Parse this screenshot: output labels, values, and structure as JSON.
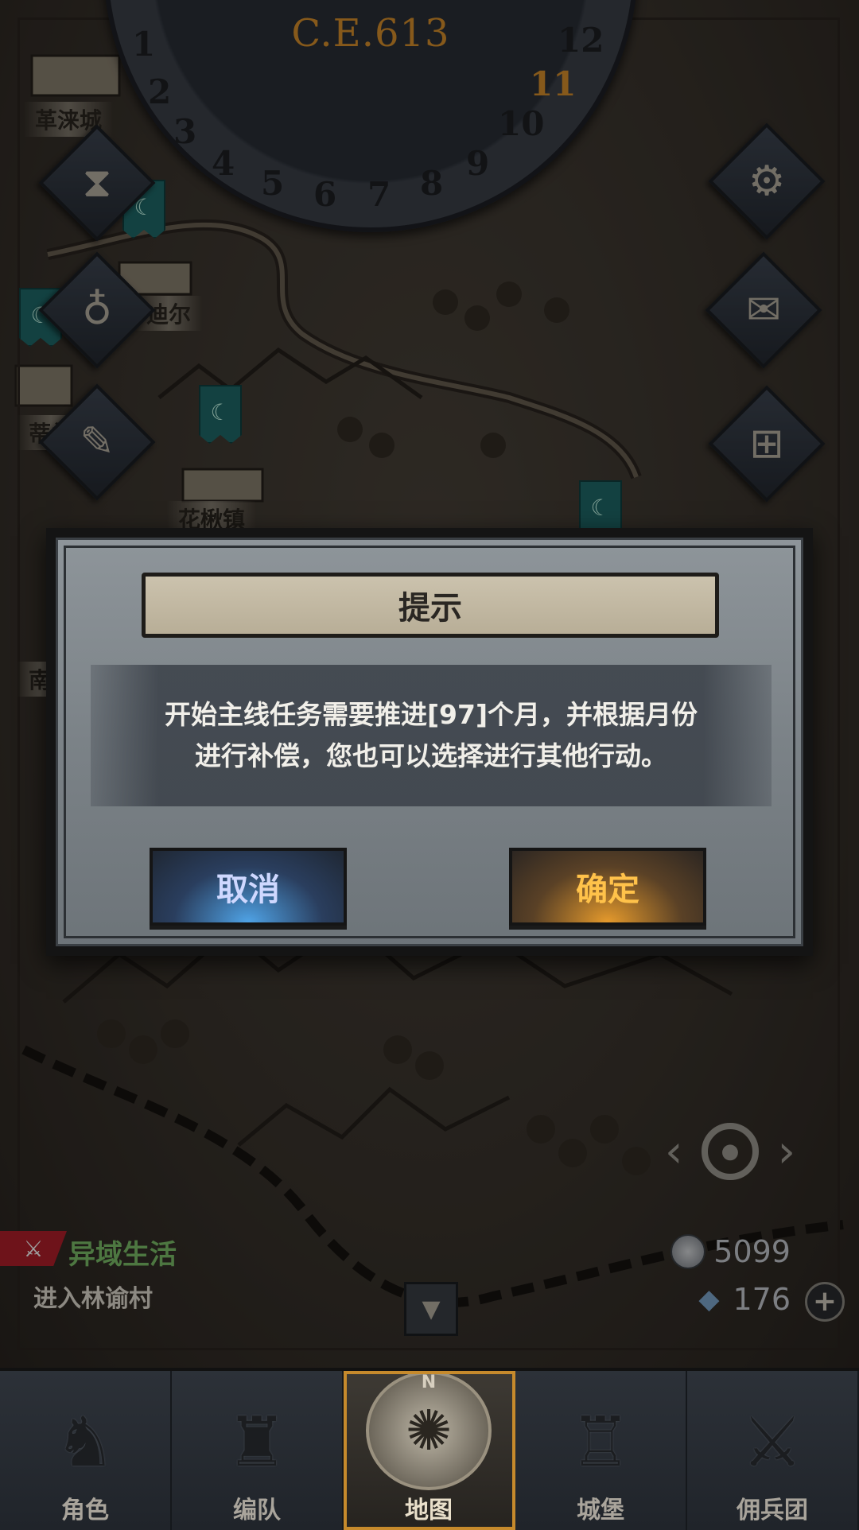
{
  "calendar": {
    "year": "C.E.613",
    "months": [
      "1",
      "2",
      "3",
      "4",
      "5",
      "6",
      "7",
      "8",
      "9",
      "10",
      "11",
      "12"
    ],
    "active_month": "11"
  },
  "map": {
    "towns": [
      "革涞城",
      "迪尔",
      "花楸镇",
      "蒂兰",
      "南"
    ]
  },
  "side_buttons": {
    "left": [
      {
        "icon": "hourglass-icon",
        "glyph": "⧗"
      },
      {
        "icon": "bag-icon",
        "glyph": "♁"
      },
      {
        "icon": "scroll-icon",
        "glyph": "✎"
      }
    ],
    "right": [
      {
        "icon": "gear-icon",
        "glyph": "⚙"
      },
      {
        "icon": "mail-icon",
        "glyph": "✉"
      },
      {
        "icon": "window-icon",
        "glyph": "⊞"
      }
    ]
  },
  "dialog": {
    "title": "提示",
    "message_line1": "开始主线任务需要推进[97]个月，并根据月份",
    "message_line2": "进行补偿，您也可以选择进行其他行动。",
    "cancel_label": "取消",
    "confirm_label": "确定"
  },
  "quest": {
    "title": "异域生活",
    "subtitle": "进入林谕村"
  },
  "resources": {
    "coins": "5099",
    "crystals": "176"
  },
  "nav": {
    "compass_letter": "N",
    "tabs": [
      {
        "label": "角色",
        "icon": "knight-icon",
        "glyph": "♞"
      },
      {
        "label": "编队",
        "icon": "helmet-icon",
        "glyph": "♜"
      },
      {
        "label": "地图",
        "icon": "compass-map-icon",
        "glyph": "✺"
      },
      {
        "label": "城堡",
        "icon": "castle-icon",
        "glyph": "♖"
      },
      {
        "label": "佣兵团",
        "icon": "mercenary-icon",
        "glyph": "⚔"
      }
    ],
    "active": "地图"
  }
}
